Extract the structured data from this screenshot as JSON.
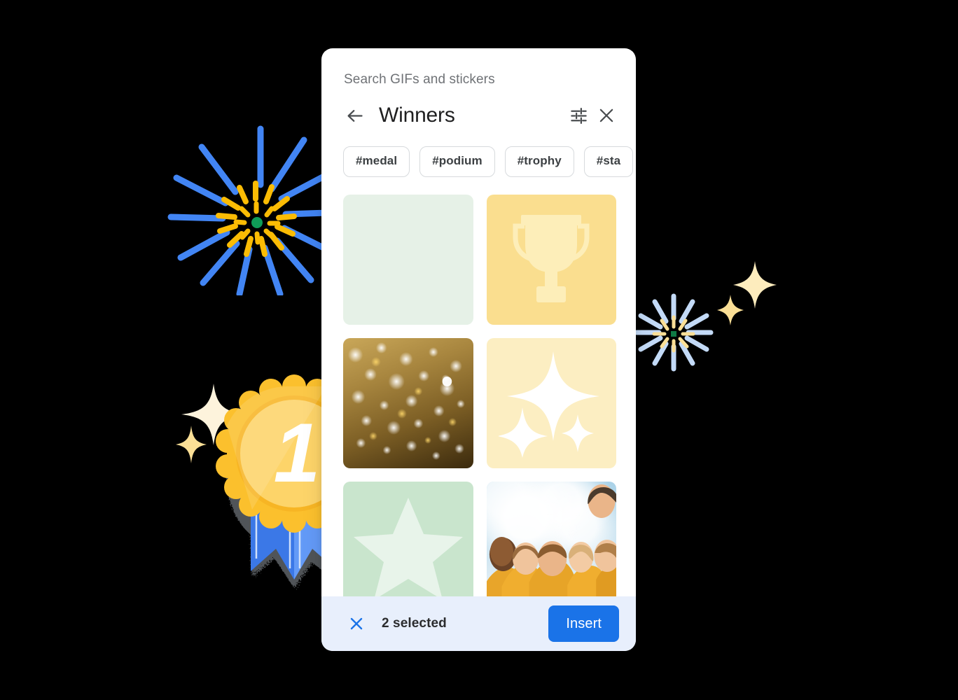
{
  "colors": {
    "panel_bg": "#ffffff",
    "accent_blue": "#1a73e8",
    "action_bar_bg": "#e8effc",
    "chip_border": "#d7dadd",
    "text_primary": "#1f1f20",
    "text_secondary": "#6f7276",
    "tile_mint_light": "#e6f1e7",
    "tile_gold": "#fade8f",
    "tile_cream": "#fceec2",
    "tile_mint": "#c9e5cd",
    "firework_blue": "#4285f4",
    "firework_light_blue": "#c3daf7",
    "firework_gold": "#fbbc04",
    "firework_center_green": "#0f9d58",
    "sparkle_cream": "#fdf2d2",
    "sparkle_gold": "#fbdf96",
    "medal_gold": "#fbc02d",
    "ribbon_blue": "#4285f4"
  },
  "search": {
    "placeholder": "Search GIFs and stickers"
  },
  "header": {
    "back_label": "Back",
    "title": "Winners",
    "tune_label": "Filters",
    "close_label": "Close"
  },
  "chips": [
    {
      "label": "#medal"
    },
    {
      "label": "#podium"
    },
    {
      "label": "#trophy"
    },
    {
      "label": "#sta"
    }
  ],
  "grid": {
    "tiles": [
      {
        "name": "tile-mint-blank",
        "kind": "solid",
        "art": "none",
        "bg": "#e6f1e7",
        "art_color": "#ffffff"
      },
      {
        "name": "tile-trophy",
        "kind": "solid",
        "art": "trophy",
        "bg": "#fade8f",
        "art_color": "#fdeeb9"
      },
      {
        "name": "tile-gold-glitter",
        "kind": "photo",
        "art": "glitter",
        "bg": "#8a6a2f",
        "art_color": "#ffffff"
      },
      {
        "name": "tile-sparkles",
        "kind": "solid",
        "art": "sparkle",
        "bg": "#fceec2",
        "art_color": "#ffffff"
      },
      {
        "name": "tile-star",
        "kind": "solid",
        "art": "star",
        "bg": "#c9e5cd",
        "art_color": "#e8f4ea"
      },
      {
        "name": "tile-team-photo",
        "kind": "photo",
        "art": "people",
        "bg": "#bcdcec",
        "art_color": "#e8a52a"
      }
    ]
  },
  "action_bar": {
    "clear_label": "Clear selection",
    "selected_text": "2 selected",
    "insert_label": "Insert"
  },
  "decorations": [
    {
      "name": "firework-blue",
      "description": "blue starburst with gold dashes and green center"
    },
    {
      "name": "firework-light-blue",
      "description": "light blue starburst with pale gold dashes"
    },
    {
      "name": "sparkle-left",
      "description": "cream four-point sparkles"
    },
    {
      "name": "sparkle-right",
      "description": "pale gold four-point sparkles"
    },
    {
      "name": "medal-illustration",
      "description": "gold first place medal with blue ribbons",
      "medal_number": "1"
    }
  ]
}
